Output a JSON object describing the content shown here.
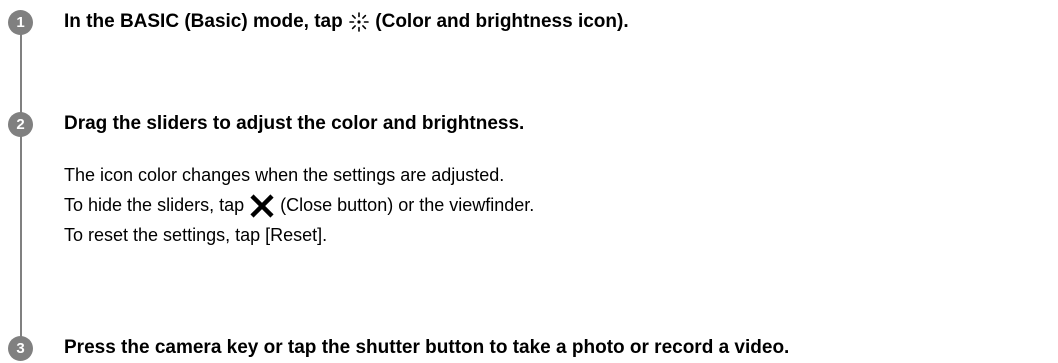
{
  "steps": [
    {
      "number": "1",
      "title_before": "In the BASIC (Basic) mode, tap",
      "title_icon": "color-brightness-icon",
      "title_after": "(Color and brightness icon)."
    },
    {
      "number": "2",
      "title": "Drag the sliders to adjust the color and brightness.",
      "body": {
        "line1": "The icon color changes when the settings are adjusted.",
        "line2_before": "To hide the sliders, tap",
        "line2_icon": "close-icon",
        "line2_after": "(Close button) or the viewfinder.",
        "line3": "To reset the settings, tap [Reset]."
      }
    },
    {
      "number": "3",
      "title": "Press the camera key or tap the shutter button to take a photo or record a video."
    }
  ],
  "colors": {
    "step_marker": "#808080",
    "text": "#000000",
    "background": "#ffffff"
  }
}
